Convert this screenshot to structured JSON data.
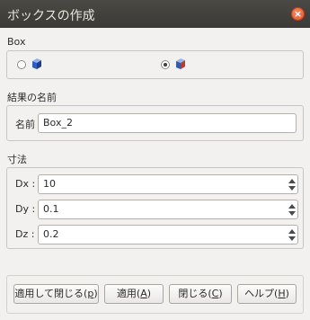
{
  "window": {
    "title": "ボックスの作成",
    "close_label": "×"
  },
  "box_section": {
    "label": "Box",
    "options": [
      {
        "icon": "cube-icon",
        "selected": false
      },
      {
        "icon": "cube-icon",
        "selected": true
      }
    ]
  },
  "name_section": {
    "label": "結果の名前",
    "field_label": "名前",
    "value": "Box_2"
  },
  "dimensions": {
    "label": "寸法",
    "fields": [
      {
        "label": "Dx :",
        "value": "10"
      },
      {
        "label": "Dy :",
        "value": "0.1"
      },
      {
        "label": "Dz :",
        "value": "0.2"
      }
    ]
  },
  "buttons": {
    "apply_close": {
      "text": "適用して閉じる(",
      "key": "p",
      "end": ")"
    },
    "apply": {
      "text": "適用(",
      "key": "A",
      "end": ")"
    },
    "close": {
      "text": "閉じる(",
      "key": "C",
      "end": ")"
    },
    "help": {
      "text": "ヘルプ(",
      "key": "H",
      "end": ")"
    }
  },
  "colors": {
    "titlebar": "#3b3a36",
    "close": "#e0542c",
    "cube": "#3b5fb0"
  }
}
